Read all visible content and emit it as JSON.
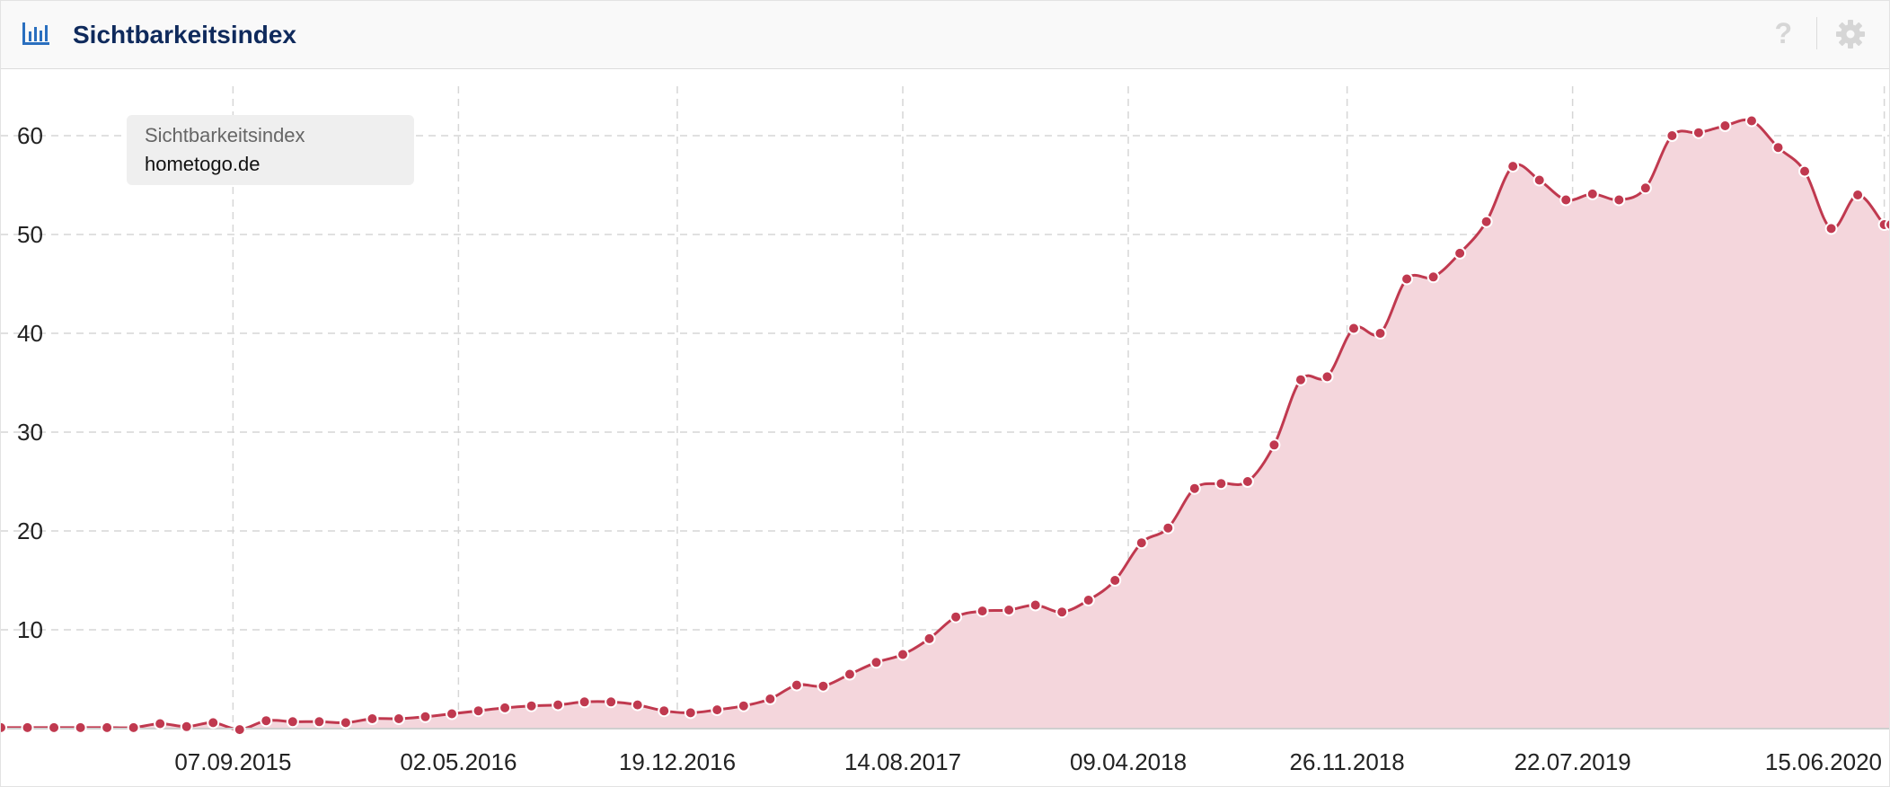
{
  "header": {
    "title": "Sichtbarkeitsindex",
    "icons": {
      "chart": "bar-chart-icon",
      "help": "help-icon",
      "help_glyph": "?",
      "settings": "gear-icon"
    }
  },
  "legend": {
    "label": "Sichtbarkeitsindex",
    "domain": "hometogo.de"
  },
  "colors": {
    "line": "#c0394f",
    "fill": "#f4d6dc",
    "title": "#0f2a5c",
    "grid": "#d6d6d6"
  },
  "chart_data": {
    "type": "area",
    "title": "Sichtbarkeitsindex",
    "xlabel": "",
    "ylabel": "",
    "ylim": [
      0,
      65
    ],
    "xlim": [
      "2015-01-05",
      "2020-06-22"
    ],
    "grid": true,
    "legend_position": "top-left",
    "yticks": [
      10,
      20,
      30,
      40,
      50,
      60
    ],
    "xticks": [
      "07.09.2015",
      "02.05.2016",
      "19.12.2016",
      "14.08.2017",
      "09.04.2018",
      "26.11.2018",
      "22.07.2019",
      "15.06.2020"
    ],
    "series": [
      {
        "name": "hometogo.de",
        "points": [
          [
            "05.01.2015",
            0.1
          ],
          [
            "02.02.2015",
            0.1
          ],
          [
            "02.03.2015",
            0.1
          ],
          [
            "30.03.2015",
            0.1
          ],
          [
            "27.04.2015",
            0.1
          ],
          [
            "25.05.2015",
            0.1
          ],
          [
            "22.06.2015",
            0.5
          ],
          [
            "20.07.2015",
            0.2
          ],
          [
            "17.08.2015",
            0.6
          ],
          [
            "14.09.2015",
            -0.1
          ],
          [
            "12.10.2015",
            0.8
          ],
          [
            "09.11.2015",
            0.7
          ],
          [
            "07.12.2015",
            0.7
          ],
          [
            "04.01.2016",
            0.6
          ],
          [
            "01.02.2016",
            1.0
          ],
          [
            "29.02.2016",
            1.0
          ],
          [
            "28.03.2016",
            1.2
          ],
          [
            "25.04.2016",
            1.5
          ],
          [
            "23.05.2016",
            1.8
          ],
          [
            "20.06.2016",
            2.1
          ],
          [
            "18.07.2016",
            2.3
          ],
          [
            "15.08.2016",
            2.4
          ],
          [
            "12.09.2016",
            2.7
          ],
          [
            "10.10.2016",
            2.7
          ],
          [
            "07.11.2016",
            2.4
          ],
          [
            "05.12.2016",
            1.8
          ],
          [
            "02.01.2017",
            1.6
          ],
          [
            "30.01.2017",
            1.9
          ],
          [
            "27.02.2017",
            2.3
          ],
          [
            "27.03.2017",
            3.0
          ],
          [
            "24.04.2017",
            4.4
          ],
          [
            "22.05.2017",
            4.3
          ],
          [
            "19.06.2017",
            5.5
          ],
          [
            "17.07.2017",
            6.7
          ],
          [
            "14.08.2017",
            7.5
          ],
          [
            "11.09.2017",
            9.1
          ],
          [
            "09.10.2017",
            11.3
          ],
          [
            "06.11.2017",
            11.9
          ],
          [
            "04.12.2017",
            12.0
          ],
          [
            "01.01.2018",
            12.5
          ],
          [
            "29.01.2018",
            11.8
          ],
          [
            "26.02.2018",
            13.0
          ],
          [
            "26.03.2018",
            15.0
          ],
          [
            "23.04.2018",
            18.8
          ],
          [
            "21.05.2018",
            20.3
          ],
          [
            "18.06.2018",
            24.3
          ],
          [
            "16.07.2018",
            24.8
          ],
          [
            "13.08.2018",
            25.0
          ],
          [
            "10.09.2018",
            28.7
          ],
          [
            "08.10.2018",
            35.3
          ],
          [
            "05.11.2018",
            35.6
          ],
          [
            "03.12.2018",
            40.5
          ],
          [
            "31.12.2018",
            40.0
          ],
          [
            "28.01.2019",
            45.5
          ],
          [
            "25.02.2019",
            45.7
          ],
          [
            "25.03.2019",
            48.1
          ],
          [
            "22.04.2019",
            51.3
          ],
          [
            "20.05.2019",
            56.9
          ],
          [
            "17.06.2019",
            55.5
          ],
          [
            "15.07.2019",
            53.5
          ],
          [
            "12.08.2019",
            54.1
          ],
          [
            "09.09.2019",
            53.5
          ],
          [
            "07.10.2019",
            54.7
          ],
          [
            "04.11.2019",
            60.0
          ],
          [
            "02.12.2019",
            60.3
          ],
          [
            "30.12.2019",
            61.0
          ],
          [
            "27.01.2020",
            61.5
          ],
          [
            "24.02.2020",
            58.8
          ],
          [
            "23.03.2020",
            56.4
          ],
          [
            "20.04.2020",
            50.6
          ],
          [
            "18.05.2020",
            54.0
          ],
          [
            "15.06.2020",
            51.0
          ],
          [
            "22.06.2020",
            51.0
          ]
        ]
      }
    ]
  }
}
